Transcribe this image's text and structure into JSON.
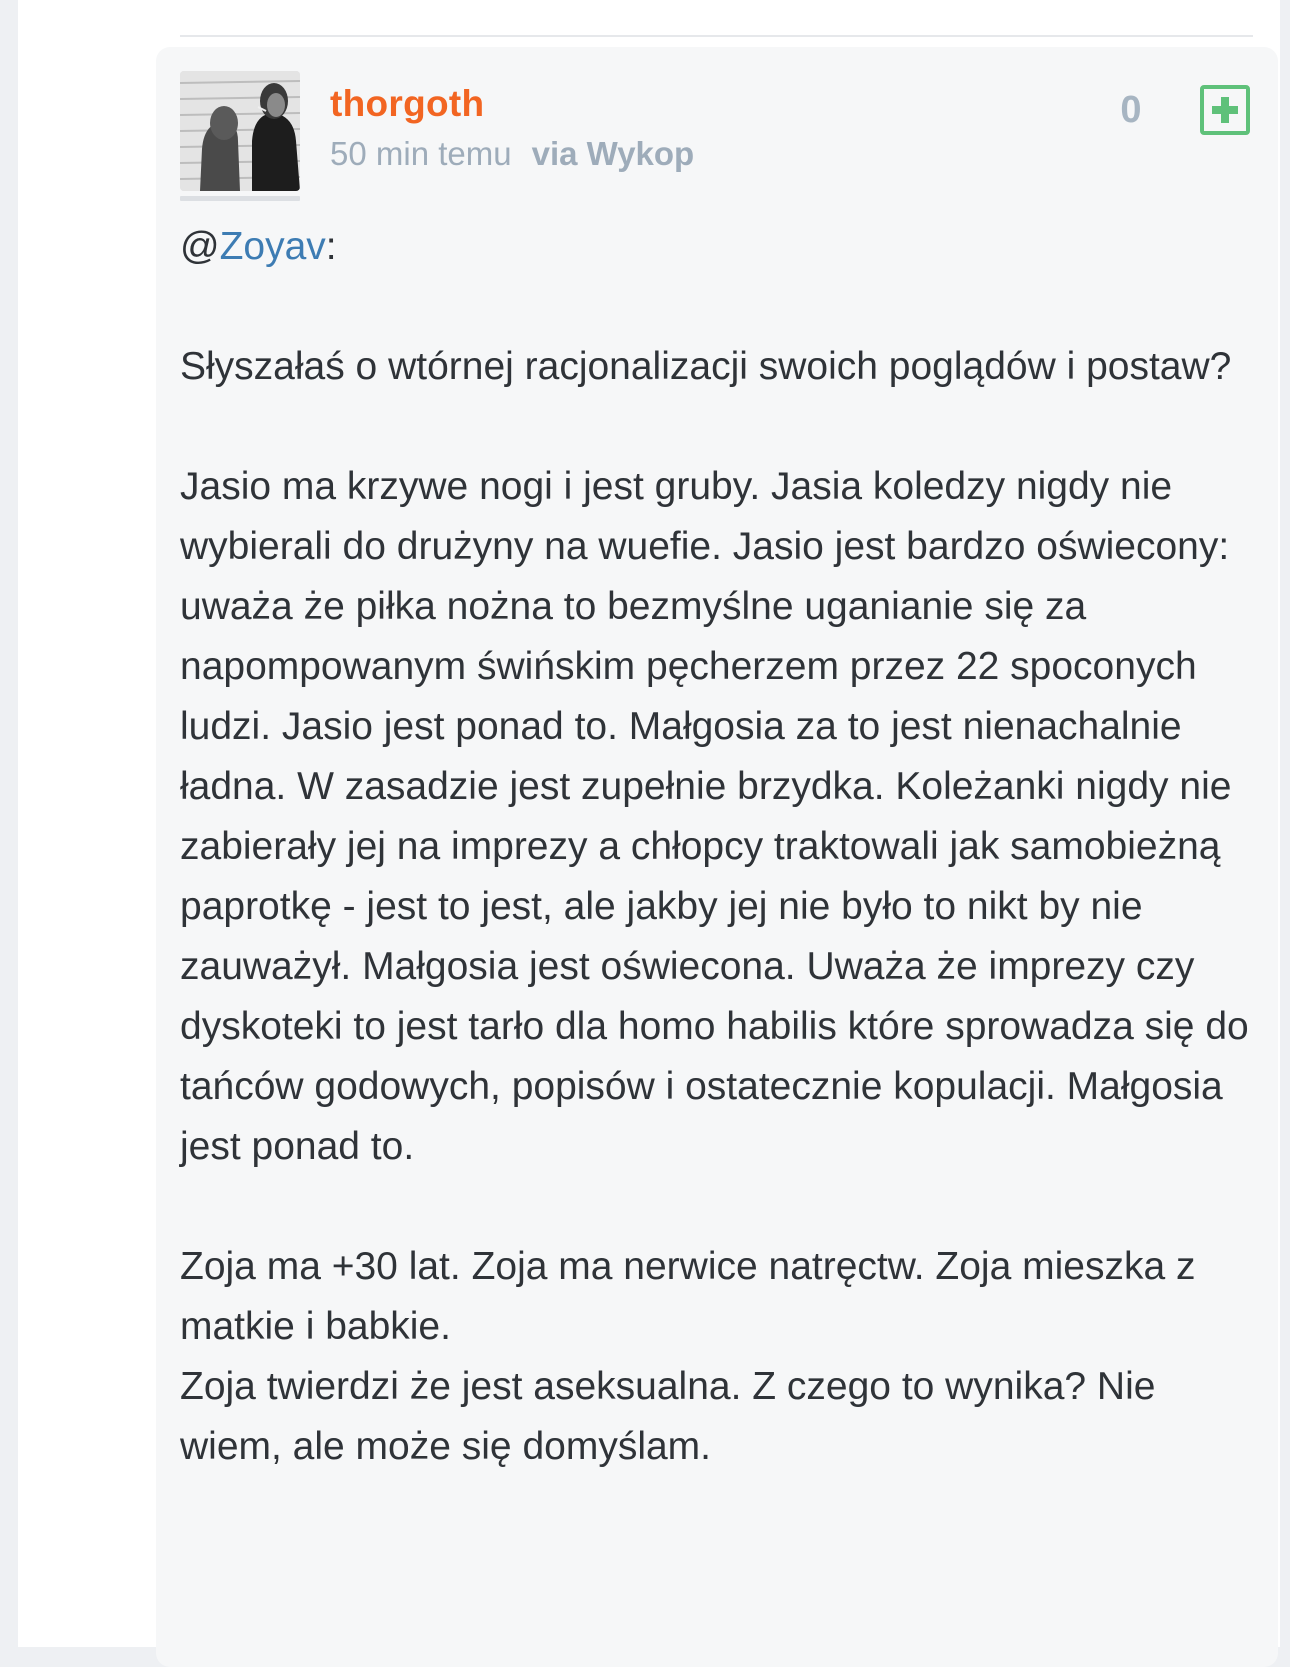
{
  "comment": {
    "username": "thorgoth",
    "time": "50 min temu",
    "via": "via Wykop",
    "vote_count": "0",
    "mention_at": "@",
    "mention_user": "Zoyav",
    "mention_colon": ":",
    "paragraphs": [
      "Słyszałaś o wtórnej racjonalizacji swoich poglądów i postaw?",
      "Jasio ma krzywe nogi i jest gruby. Jasia koledzy nigdy nie wybierali do drużyny na wuefie. Jasio jest bardzo oświecony: uważa że piłka nożna to bezmyślne uganianie się za napompowanym świńskim pęcherzem przez 22 spoconych ludzi. Jasio jest ponad to. Małgosia za to jest nienachalnie ładna. W zasadzie jest zupełnie brzydka. Koleżanki nigdy nie zabierały jej na imprezy a chłopcy traktowali jak samobieżną paprotkę - jest to jest, ale jakby jej nie było to nikt by nie zauważył. Małgosia jest oświecona. Uważa że imprezy czy dyskoteki to jest tarło dla homo habilis które sprowadza się do tańców godowych, popisów i ostatecznie kopulacji. Małgosia jest ponad to.",
      "Zoja ma +30 lat. Zoja ma nerwice natręctw. Zoja mieszka z matkie i babkie.",
      "Zoja twierdzi że jest aseksualna. Z czego to wynika? Nie wiem, ale może się domyślam."
    ]
  },
  "colors": {
    "username": "#f26522",
    "mention": "#3d7cb3",
    "meta": "#9eacba",
    "plus": "#5fc17a"
  },
  "icons": {
    "plus_button": "plus-square-icon"
  }
}
